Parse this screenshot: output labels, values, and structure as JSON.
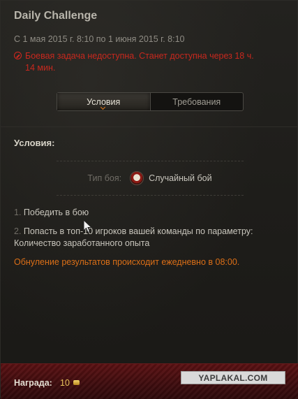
{
  "header": {
    "title": "Daily Challenge",
    "dates": "С 1 мая 2015 г. 8:10 по 1 июня 2015 г. 8:10",
    "warning": "Боевая задача недоступна. Станет доступна через 18 ч. 14 мин."
  },
  "tabs": [
    {
      "label": "Условия",
      "active": true
    },
    {
      "label": "Требования",
      "active": false
    }
  ],
  "conditions": {
    "title": "Условия:",
    "battle_type_label": "Тип боя:",
    "battle_type_value": "Случайный бой",
    "items": [
      {
        "num": "1.",
        "text": "Победить в бою"
      },
      {
        "num": "2.",
        "text": "Попасть в топ-10 игроков вашей команды по параметру:",
        "text2": "Количество заработанного опыта"
      }
    ],
    "reset_note": "Обнуление результатов происходит ежедневно в 08:00."
  },
  "reward": {
    "label": "Награда:",
    "value": "10"
  },
  "watermark": "YAPLAKAL.COM",
  "colors": {
    "warning": "#c8281e",
    "accent": "#dc6f17",
    "reward_bar": "#4a0e10",
    "gold": "#e6c35a"
  },
  "icons": {
    "warning": "error-circle-icon",
    "battle_type": "random-battle-icon",
    "currency": "gold-icon",
    "cursor": "mouse-cursor-icon"
  }
}
